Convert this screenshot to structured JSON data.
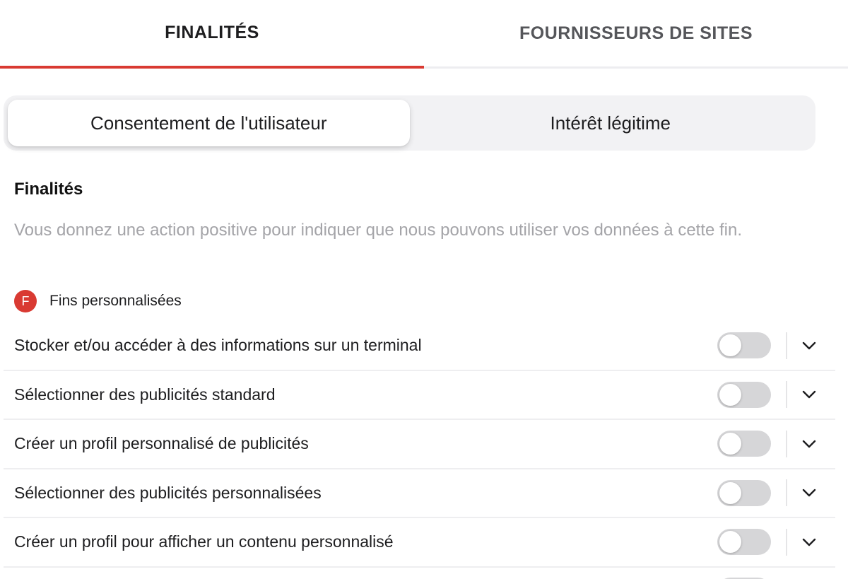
{
  "tabs": [
    {
      "label": "FINALITÉS",
      "active": true
    },
    {
      "label": "FOURNISSEURS DE SITES",
      "active": false
    }
  ],
  "segmented": {
    "options": [
      "Consentement de l'utilisateur",
      "Intérêt légitime"
    ],
    "selected": "Consentement de l'utilisateur"
  },
  "section": {
    "title": "Finalités",
    "description": "Vous donnez une action positive pour indiquer que nous pouvons utiliser vos données à cette fin."
  },
  "legend": {
    "badge": "F",
    "label": "Fins personnalisées"
  },
  "purposes": [
    {
      "label": "Stocker et/ou accéder à des informations sur un terminal",
      "enabled": false
    },
    {
      "label": "Sélectionner des publicités standard",
      "enabled": false
    },
    {
      "label": "Créer un profil personnalisé de publicités",
      "enabled": false
    },
    {
      "label": "Sélectionner des publicités personnalisées",
      "enabled": false
    },
    {
      "label": "Créer un profil pour afficher un contenu personnalisé",
      "enabled": false
    }
  ],
  "icons": {
    "expand": "chevron-down-icon"
  },
  "colors": {
    "accent": "#d93a32",
    "toggle_off": "#d6d6d8",
    "muted_text": "#a4a4a8"
  }
}
